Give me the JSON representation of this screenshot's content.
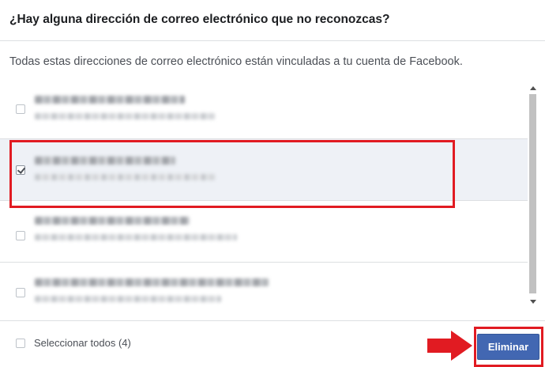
{
  "dialog": {
    "title": "¿Hay alguna dirección de correo electrónico que no reconozcas?",
    "description": "Todas estas direcciones de correo electrónico están vinculadas a tu cuenta de Facebook."
  },
  "emails": [
    {
      "checked": false,
      "label_visible": "redacted (blurred)"
    },
    {
      "checked": true,
      "label_visible": "redacted (blurred)"
    },
    {
      "checked": false,
      "label_visible": "redacted (blurred)"
    },
    {
      "checked": false,
      "label_visible": "redacted (blurred)"
    }
  ],
  "footer": {
    "select_all_label": "Seleccionar todos (4)",
    "delete_label": "Eliminar"
  },
  "colors": {
    "accent": "#4267b2",
    "annotation_red": "#e11b22",
    "selected_row": "#eef1f6"
  }
}
